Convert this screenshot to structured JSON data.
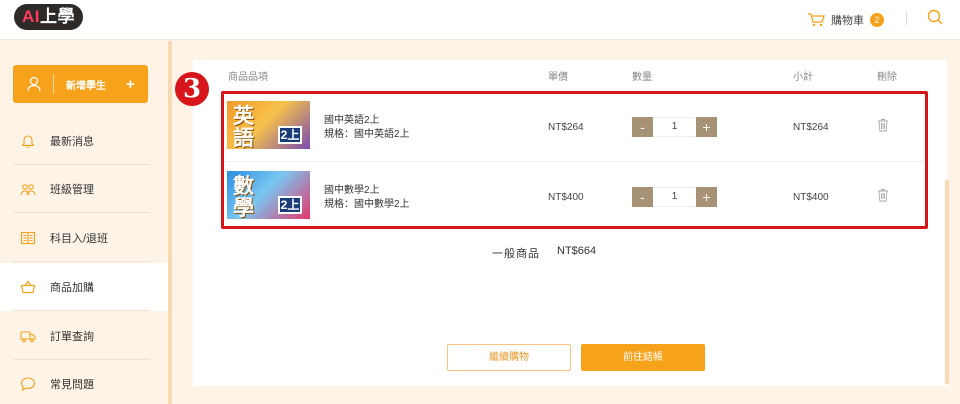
{
  "header": {
    "logo_ai": "AI",
    "logo_text": "上學",
    "cart_label": "購物車",
    "cart_count": "2"
  },
  "sidebar": {
    "add_student_label": "新增學生",
    "add_student_plus": "+",
    "items": [
      {
        "label": "最新消息",
        "icon": "bell-icon"
      },
      {
        "label": "班級管理",
        "icon": "users-icon"
      },
      {
        "label": "科目入/退班",
        "icon": "book-icon"
      },
      {
        "label": "商品加購",
        "icon": "basket-icon",
        "active": true
      },
      {
        "label": "訂單查詢",
        "icon": "truck-icon"
      },
      {
        "label": "常見問題",
        "icon": "chat-bubble-icon"
      }
    ]
  },
  "cart_table": {
    "headers": {
      "item": "商品品項",
      "unit_price": "單價",
      "quantity": "數量",
      "subtotal": "小計",
      "delete": "刪除"
    },
    "rows": [
      {
        "thumb_text": "英語",
        "thumb_tag": "2上",
        "name": "國中英語2上",
        "spec": "規格：國中英語2上",
        "price": "NT$264",
        "qty": "1",
        "subtotal": "NT$264",
        "thumb_colors": [
          "#f39a2c",
          "#7a4bb0"
        ]
      },
      {
        "thumb_text": "數學",
        "thumb_tag": "2上",
        "name": "國中數學2上",
        "spec": "規格：國中數學2上",
        "price": "NT$400",
        "qty": "1",
        "subtotal": "NT$400",
        "thumb_colors": [
          "#2c8fe0",
          "#e5376b"
        ]
      }
    ],
    "qty_minus": "-",
    "qty_plus": "+",
    "summary_label": "一般商品",
    "summary_value": "NT$664"
  },
  "actions": {
    "continue_label": "繼續購物",
    "checkout_label": "前往結帳"
  },
  "step_badge": "3",
  "colors": {
    "accent": "#f7a21b",
    "highlight": "#d7151a",
    "qty_button": "#a89276"
  }
}
